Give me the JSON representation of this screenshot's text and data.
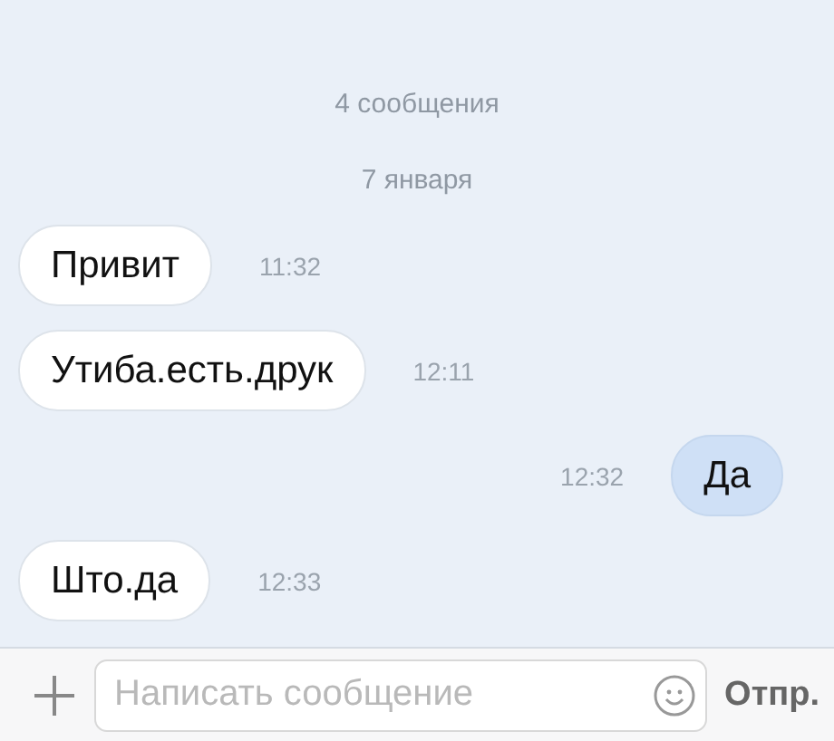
{
  "header": {
    "count": "4 сообщения",
    "date": "7 января"
  },
  "messages": [
    {
      "kind": "incoming",
      "text": "Привит",
      "time": "11:32"
    },
    {
      "kind": "incoming",
      "text": "Утиба.есть.друк",
      "time": "12:11"
    },
    {
      "kind": "outgoing",
      "text": "Да",
      "time": "12:32"
    },
    {
      "kind": "incoming",
      "text": "Што.да",
      "time": "12:33"
    }
  ],
  "composer": {
    "placeholder": "Написать сообщение",
    "send": "Отпр."
  }
}
